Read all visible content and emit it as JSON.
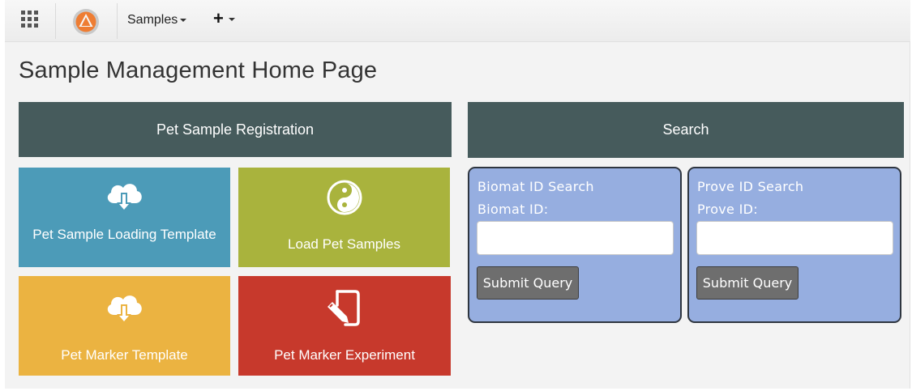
{
  "nav": {
    "apps_icon": "grid-icon",
    "logo_icon": "orange-circle-logo",
    "samples_label": "Samples",
    "add_label": "+"
  },
  "page": {
    "title": "Sample Management Home Page"
  },
  "registration": {
    "header": "Pet Sample Registration",
    "tiles": [
      {
        "label": "Pet Sample Loading Template",
        "icon": "cloud-download-icon",
        "color": "#4c9bb8"
      },
      {
        "label": "Load Pet Samples",
        "icon": "yin-yang-icon",
        "color": "#a9b33d"
      },
      {
        "label": "Pet Marker Template",
        "icon": "cloud-download-icon",
        "color": "#ebb341"
      },
      {
        "label": "Pet Marker Experiment",
        "icon": "edit-document-icon",
        "color": "#c7392c"
      }
    ]
  },
  "search": {
    "header": "Search",
    "panels": [
      {
        "title": "Biomat ID Search",
        "field_label": "Biomat ID:",
        "value": "",
        "button": "Submit Query"
      },
      {
        "title": "Prove ID Search",
        "field_label": "Prove ID:",
        "value": "",
        "button": "Submit Query"
      }
    ]
  },
  "colors": {
    "header_bar": "#465b5c",
    "panel_bg": "#96aee0",
    "logo_orange": "#ee7d33"
  }
}
